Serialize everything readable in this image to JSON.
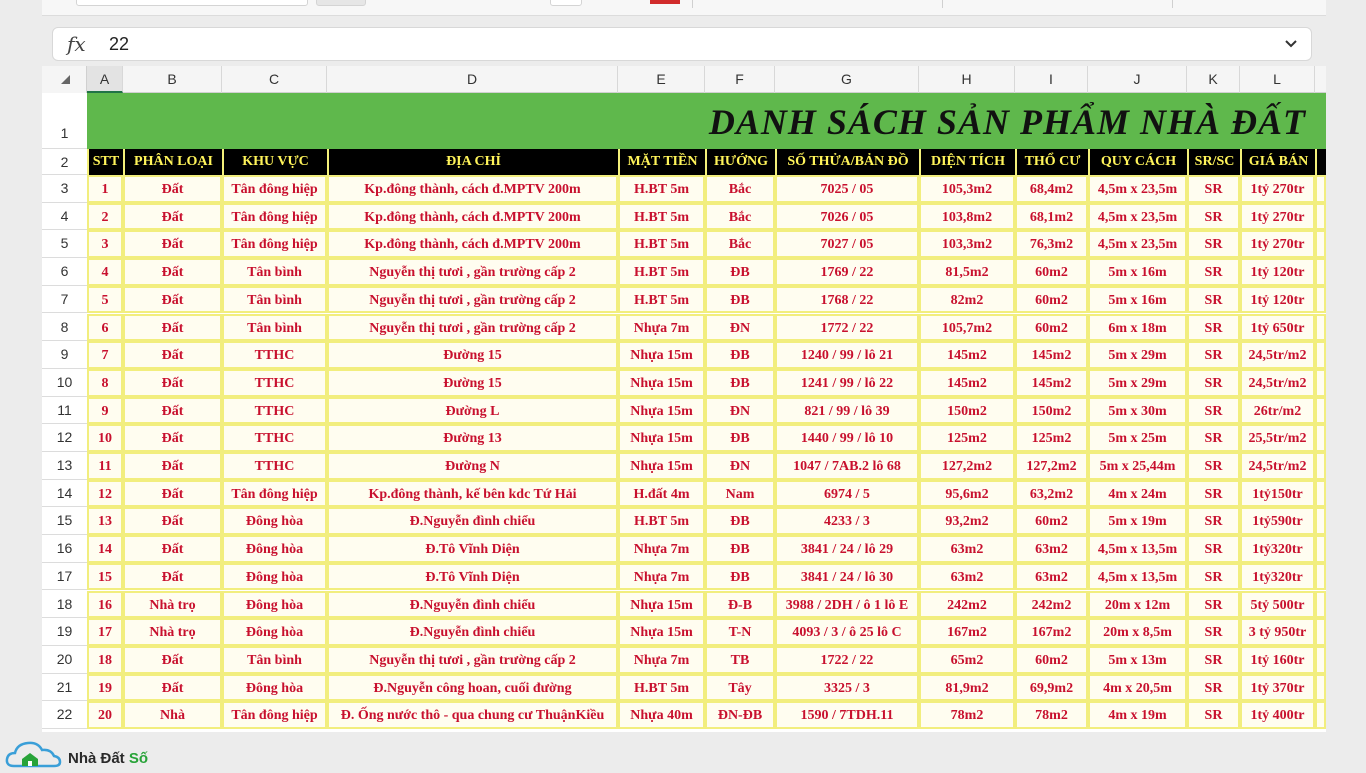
{
  "formula_bar": {
    "fx": "fx",
    "value": "22"
  },
  "columns": [
    "A",
    "B",
    "C",
    "D",
    "E",
    "F",
    "G",
    "H",
    "I",
    "J",
    "K",
    "L"
  ],
  "active_column": "A",
  "row_numbers": [
    "1",
    "2",
    "3",
    "4",
    "5",
    "6",
    "7",
    "8",
    "9",
    "10",
    "11",
    "12",
    "13",
    "14",
    "15",
    "16",
    "17",
    "18",
    "19",
    "20",
    "21",
    "22"
  ],
  "sheet": {
    "title": "DANH SÁCH SẢN PHẨM NHÀ ĐẤT",
    "headers": [
      "STT",
      "PHÂN LOẠI",
      "KHU VỰC",
      "ĐỊA CHỈ",
      "MẶT TIỀN",
      "HƯỚNG",
      "SỐ THỬA/BẢN ĐỒ",
      "DIỆN TÍCH",
      "THỔ CƯ",
      "QUY CÁCH",
      "SR/SC",
      "GIÁ BÁN"
    ],
    "rows": [
      [
        "1",
        "Đất",
        "Tân đông hiệp",
        "Kp.đông thành, cách đ.MPTV 200m",
        "H.BT 5m",
        "Bắc",
        "7025 / 05",
        "105,3m2",
        "68,4m2",
        "4,5m x 23,5m",
        "SR",
        "1tỷ 270tr"
      ],
      [
        "2",
        "Đất",
        "Tân đông hiệp",
        "Kp.đông thành, cách đ.MPTV 200m",
        "H.BT 5m",
        "Bắc",
        "7026 / 05",
        "103,8m2",
        "68,1m2",
        "4,5m x 23,5m",
        "SR",
        "1tỷ 270tr"
      ],
      [
        "3",
        "Đất",
        "Tân đông hiệp",
        "Kp.đông thành, cách đ.MPTV 200m",
        "H.BT 5m",
        "Bắc",
        "7027 / 05",
        "103,3m2",
        "76,3m2",
        "4,5m x 23,5m",
        "SR",
        "1tỷ 270tr"
      ],
      [
        "4",
        "Đất",
        "Tân bình",
        "Nguyễn thị tươi , gần trường cấp 2",
        "H.BT 5m",
        "ĐB",
        "1769 / 22",
        "81,5m2",
        "60m2",
        "5m x 16m",
        "SR",
        "1tỷ 120tr"
      ],
      [
        "5",
        "Đất",
        "Tân bình",
        "Nguyễn thị tươi , gần trường cấp 2",
        "H.BT 5m",
        "ĐB",
        "1768 / 22",
        "82m2",
        "60m2",
        "5m x 16m",
        "SR",
        "1tỷ 120tr"
      ],
      [
        "6",
        "Đất",
        "Tân bình",
        "Nguyễn thị tươi , gần trường cấp 2",
        "Nhựa 7m",
        "ĐN",
        "1772 / 22",
        "105,7m2",
        "60m2",
        "6m x 18m",
        "SR",
        "1tỷ 650tr"
      ],
      [
        "7",
        "Đất",
        "TTHC",
        "Đường 15",
        "Nhựa 15m",
        "ĐB",
        "1240 / 99 / lô 21",
        "145m2",
        "145m2",
        "5m x 29m",
        "SR",
        "24,5tr/m2"
      ],
      [
        "8",
        "Đất",
        "TTHC",
        "Đường 15",
        "Nhựa 15m",
        "ĐB",
        "1241 / 99 / lô 22",
        "145m2",
        "145m2",
        "5m x 29m",
        "SR",
        "24,5tr/m2"
      ],
      [
        "9",
        "Đất",
        "TTHC",
        "Đường L",
        "Nhựa 15m",
        "ĐN",
        "821 / 99 / lô 39",
        "150m2",
        "150m2",
        "5m x 30m",
        "SR",
        "26tr/m2"
      ],
      [
        "10",
        "Đất",
        "TTHC",
        "Đường 13",
        "Nhựa 15m",
        "ĐB",
        "1440 / 99 / lô 10",
        "125m2",
        "125m2",
        "5m x 25m",
        "SR",
        "25,5tr/m2"
      ],
      [
        "11",
        "Đất",
        "TTHC",
        "Đường N",
        "Nhựa 15m",
        "ĐN",
        "1047 / 7AB.2 lô 68",
        "127,2m2",
        "127,2m2",
        "5m x 25,44m",
        "SR",
        "24,5tr/m2"
      ],
      [
        "12",
        "Đất",
        "Tân đông hiệp",
        "Kp.đông thành, kế bên kdc Tứ Hải",
        "H.đất 4m",
        "Nam",
        "6974 / 5",
        "95,6m2",
        "63,2m2",
        "4m x 24m",
        "SR",
        "1tỷ150tr"
      ],
      [
        "13",
        "Đất",
        "Đông hòa",
        "Đ.Nguyễn đình chiểu",
        "H.BT 5m",
        "ĐB",
        "4233 / 3",
        "93,2m2",
        "60m2",
        "5m x 19m",
        "SR",
        "1tỷ590tr"
      ],
      [
        "14",
        "Đất",
        "Đông hòa",
        "Đ.Tô Vĩnh Diện",
        "Nhựa 7m",
        "ĐB",
        "3841 / 24 / lô 29",
        "63m2",
        "63m2",
        "4,5m x 13,5m",
        "SR",
        "1tỷ320tr"
      ],
      [
        "15",
        "Đất",
        "Đông hòa",
        "Đ.Tô Vĩnh Diện",
        "Nhựa 7m",
        "ĐB",
        "3841 / 24 / lô 30",
        "63m2",
        "63m2",
        "4,5m x 13,5m",
        "SR",
        "1tỷ320tr"
      ],
      [
        "16",
        "Nhà trọ",
        "Đông hòa",
        "Đ.Nguyễn đình chiểu",
        "Nhựa 15m",
        "Đ-B",
        "3988 / 2DH / ô 1 lô E",
        "242m2",
        "242m2",
        "20m x 12m",
        "SR",
        "5tỷ 500tr"
      ],
      [
        "17",
        "Nhà trọ",
        "Đông hòa",
        "Đ.Nguyễn đình chiểu",
        "Nhựa 15m",
        "T-N",
        "4093 / 3 / ô 25 lô C",
        "167m2",
        "167m2",
        "20m x 8,5m",
        "SR",
        "3 tỷ 950tr"
      ],
      [
        "18",
        "Đất",
        "Tân bình",
        "Nguyễn thị tươi , gần trường cấp 2",
        "Nhựa 7m",
        "TB",
        "1722 / 22",
        "65m2",
        "60m2",
        "5m x 13m",
        "SR",
        "1tỷ 160tr"
      ],
      [
        "19",
        "Đất",
        "Đông hòa",
        "Đ.Nguyễn công hoan, cuối đường",
        "H.BT 5m",
        "Tây",
        "3325 / 3",
        "81,9m2",
        "69,9m2",
        "4m x 20,5m",
        "SR",
        "1tỷ 370tr"
      ],
      [
        "20",
        "Nhà",
        "Tân đông hiệp",
        "Đ. Ống nước thô - qua chung cư ThuậnKiều",
        "Nhựa 40m",
        "ĐN-ĐB",
        "1590 / 7TDH.11",
        "78m2",
        "78m2",
        "4m x 19m",
        "SR",
        "1tỷ 400tr"
      ]
    ]
  },
  "watermark": {
    "brand": "Nhà Đất",
    "brand_accent": "Số",
    "brand_color": "#27a338"
  },
  "colors": {
    "title_band": "#5fb84c",
    "header_bg": "#000000",
    "header_text": "#fff45a",
    "cell_text": "#c8102e",
    "cell_border": "#f2ee7e"
  }
}
